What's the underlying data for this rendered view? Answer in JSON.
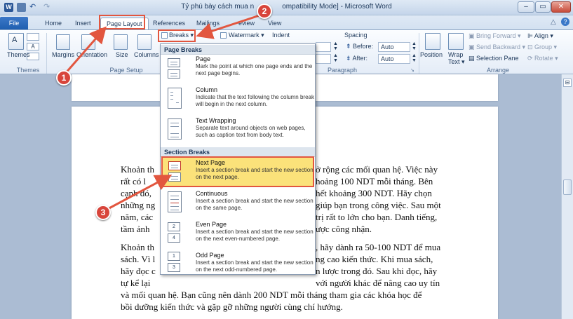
{
  "window": {
    "title": "Tỷ phú bày cách mua n",
    "title_suffix": "ompatibility Mode] - Microsoft Word",
    "controls": {
      "minimize": "–",
      "maximize": "▭",
      "close": "✕"
    }
  },
  "tabs": [
    {
      "label": "File"
    },
    {
      "label": "Home"
    },
    {
      "label": "Insert"
    },
    {
      "label": "Page Layout"
    },
    {
      "label": "References"
    },
    {
      "label": "Mailings"
    },
    {
      "label": "eview"
    },
    {
      "label": "View"
    }
  ],
  "ribbon": {
    "themes": {
      "themes_label": "Themes",
      "group_label": "Themes"
    },
    "page_setup": {
      "margins": "Margins",
      "orientation": "Orientation",
      "size": "Size",
      "columns": "Columns",
      "group_label": "Page Setup"
    },
    "breaks_button": "Breaks ▾",
    "watermark_button": "Watermark ▾",
    "indent_label": "Indent",
    "spacing_label": "Spacing",
    "before_label": "Before:",
    "before_value": "Auto",
    "after_label": "After:",
    "after_value": "Auto",
    "paragraph_label": "Paragraph",
    "position": "Position",
    "wrap_text": "Wrap\nText ▾",
    "bring_forward": "Bring Forward ▾",
    "send_backward": "Send Backward ▾",
    "selection_pane": "Selection Pane",
    "align": "Align ▾",
    "group": "Group ▾",
    "rotate": "Rotate ▾",
    "arrange_label": "Arrange"
  },
  "dropdown": {
    "page_breaks_header": "Page Breaks",
    "section_breaks_header": "Section Breaks",
    "items": [
      {
        "title": "Page",
        "desc": "Mark the point at which one page ends and the next page begins."
      },
      {
        "title": "Column",
        "desc": "Indicate that the text following the column break will begin in the next column."
      },
      {
        "title": "Text Wrapping",
        "desc": "Separate text around objects on web pages, such as caption text from body text."
      },
      {
        "title": "Next Page",
        "desc": "Insert a section break and start the new section on the next page."
      },
      {
        "title": "Continuous",
        "desc": "Insert a section break and start the new section on the same page."
      },
      {
        "title": "Even Page",
        "desc": "Insert a section break and start the new section on the next even-numbered page."
      },
      {
        "title": "Odd Page",
        "desc": "Insert a section break and start the new section on the next odd-numbered page."
      }
    ]
  },
  "document": {
    "para1_left": [
      "Khoản th",
      "rất có l",
      "cạnh đó, ",
      "những ng",
      "năm, các",
      "tầm ảnh"
    ],
    "para1_right": [
      "ở rộng các mối quan hệ. Việc này",
      "hoảng 100 NDT mỗi tháng. Bên",
      "hết khoảng 300 NDT. Hãy chọn",
      "giúp bạn trong công việc. Sau một",
      "trị rất to lớn cho bạn. Danh tiếng,",
      "ược công nhận."
    ],
    "para2_left": [
      "Khoản th",
      "sách. Vì l",
      "hãy đọc c",
      "tự kể lại "
    ],
    "para2_right": [
      ", hãy dành ra 50-100 NDT để mua",
      "ng cao kiến thức. Khi mua sách,",
      "n lược trong đó. Sau khi đọc, hãy",
      "với người khác để nâng cao uy tín"
    ],
    "para2_full": [
      "và mối quan hệ. Bạn cũng nên dành 200 NDT mỗi tháng tham gia các khóa học để",
      "bồi dưỡng kiến thức và gặp gỡ những người cùng chí hướng."
    ]
  },
  "callouts": [
    "1",
    "2",
    "3"
  ],
  "colors": {
    "annotation": "#e2563f",
    "highlight": "#fbe27a",
    "file_tab": "#2a6bc0"
  }
}
